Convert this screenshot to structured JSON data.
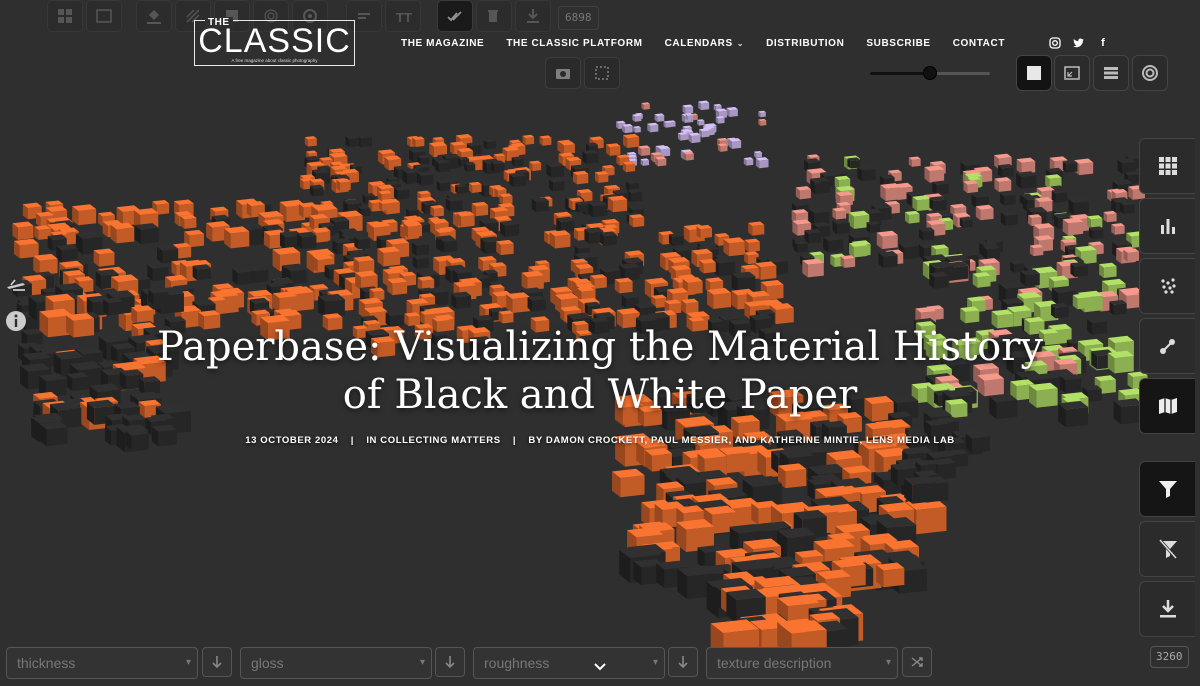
{
  "site": {
    "logo_the": "THE",
    "logo_main": "CLASSIC",
    "logo_tagline": "A free magazine about classic photography"
  },
  "nav": [
    {
      "label": "THE MAGAZINE"
    },
    {
      "label": "THE CLASSIC PLATFORM"
    },
    {
      "label": "CALENDARS",
      "dropdown": true
    },
    {
      "label": "DISTRIBUTION"
    },
    {
      "label": "SUBSCRIBE"
    },
    {
      "label": "CONTACT"
    }
  ],
  "social_icons": [
    "instagram-icon",
    "twitter-icon",
    "facebook-icon"
  ],
  "toolbar": {
    "count": "6898",
    "icons": [
      "grid-icon",
      "image-grid-icon",
      "fill-icon",
      "texture-icon",
      "square-icon",
      "fingerprint-icon",
      "target-icon",
      "align-icon",
      "text-size-icon",
      "check-all-icon",
      "clear-icon",
      "download-icon"
    ],
    "active_icon": "check-all-icon"
  },
  "zoom": {
    "level": 0.5
  },
  "view_modes": [
    "square-view-icon",
    "expand-view-icon",
    "list-view-icon",
    "target-view-icon"
  ],
  "side_panel": {
    "icons": [
      "grid-icon",
      "bar-chart-icon",
      "scatter-icon",
      "network-icon",
      "map-icon",
      "filter-icon",
      "filter-off-icon",
      "download-icon"
    ],
    "active": [
      "map-icon",
      "filter-icon"
    ],
    "count": "3260"
  },
  "article": {
    "title_line1": "Paperbase: Visualizing the Material History",
    "title_line2": "of Black and White Paper",
    "date": "13 OCTOBER 2024",
    "category": "IN COLLECTING MATTERS",
    "byline": "BY DAMON CROCKETT, PAUL MESSIER, AND KATHERINE MINTIE, LENS MEDIA LAB",
    "separator": "|"
  },
  "sort_fields": [
    {
      "placeholder": "thickness"
    },
    {
      "placeholder": "gloss"
    },
    {
      "placeholder": "roughness"
    },
    {
      "placeholder": "texture description"
    }
  ],
  "colors": {
    "background": "#2f2f2f",
    "orange": "#d9652b",
    "dark_cube": "#2a2a2a",
    "pink": "#d4857a",
    "green": "#9cc45a",
    "lavender": "#b9a8d6"
  }
}
